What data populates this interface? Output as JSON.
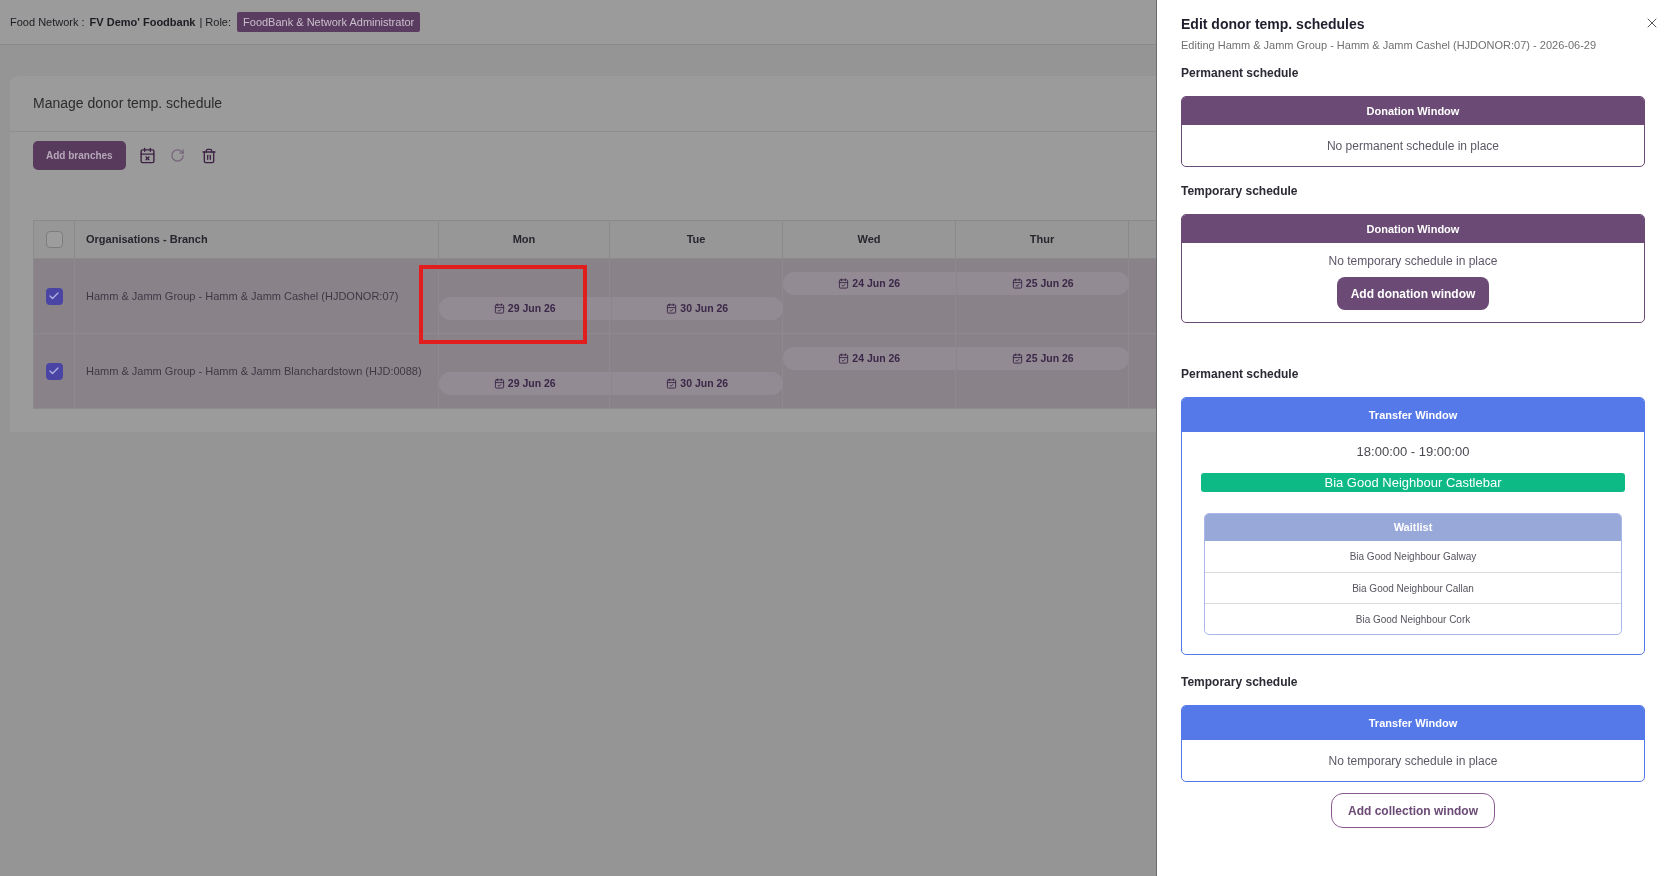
{
  "header": {
    "network_label": "Food Network :",
    "network_name": "FV Demo' Foodbank",
    "separator": "|",
    "role_label": "Role:",
    "role": "FoodBank & Network Administrator"
  },
  "page": {
    "title": "Manage donor temp. schedule",
    "add_button": "Add branches",
    "icon_buttons": [
      {
        "kind": "clear_dates",
        "disabled": false
      },
      {
        "kind": "refresh",
        "disabled": true
      },
      {
        "kind": "delete",
        "disabled": false
      }
    ]
  },
  "table": {
    "select_all_checked": false,
    "columns": [
      "Organisations - Branch",
      "Mon",
      "Tue",
      "Wed",
      "Thur"
    ],
    "rows": [
      {
        "checked": true,
        "branch": "Hamm & Jamm Group - Hamm & Jamm Cashel (HJDONOR:07)",
        "events": [
          {
            "kind": "wednesday",
            "dates": [
              {
                "text": "24 Jun 26",
                "highlighted": false
              },
              {
                "text": "25 Jun 26",
                "highlighted": false
              }
            ]
          },
          {
            "kind": "monday",
            "dates": [
              {
                "text": "29 Jun 26",
                "highlighted": true
              },
              {
                "text": "30 Jun 26",
                "highlighted": false
              }
            ]
          }
        ]
      },
      {
        "checked": true,
        "branch": "Hamm & Jamm Group - Hamm & Jamm Blanchardstown (HJD:0088)",
        "events": [
          {
            "kind": "wednesday",
            "dates": [
              {
                "text": "24 Jun 26",
                "highlighted": false
              },
              {
                "text": "25 Jun 26",
                "highlighted": false
              }
            ]
          },
          {
            "kind": "monday",
            "dates": [
              {
                "text": "29 Jun 26",
                "highlighted": false
              },
              {
                "text": "30 Jun 26",
                "highlighted": false
              }
            ]
          }
        ]
      }
    ]
  },
  "drawer": {
    "title": "Edit donor temp. schedules",
    "subtitle": "Editing Hamm & Jamm Group - Hamm & Jamm Cashel (HJDONOR:07) - 2026-06-29",
    "groups": [
      {
        "kind": "donation",
        "sections": [
          {
            "label": "Permanent schedule",
            "card": {
              "header": "Donation Window",
              "empty_text": "No permanent schedule in place"
            }
          },
          {
            "label": "Temporary schedule",
            "card": {
              "header": "Donation Window",
              "empty_text": "No temporary schedule in place",
              "action": "Add donation window"
            }
          }
        ]
      },
      {
        "kind": "transfer",
        "sections": [
          {
            "label": "Permanent schedule",
            "card": {
              "header": "Transfer Window",
              "time": "18:00:00 - 19:00:00",
              "assigned": "Bia Good Neighbour Castlebar",
              "waitlist": {
                "title": "Waitlist",
                "items": [
                  "Bia Good Neighbour Galway",
                  "Bia Good Neighbour Callan",
                  "Bia Good Neighbour Cork"
                ]
              }
            }
          },
          {
            "label": "Temporary schedule",
            "card": {
              "header": "Transfer Window",
              "empty_text": "No temporary schedule in place"
            },
            "action_below": "Add collection window"
          }
        ]
      }
    ]
  }
}
